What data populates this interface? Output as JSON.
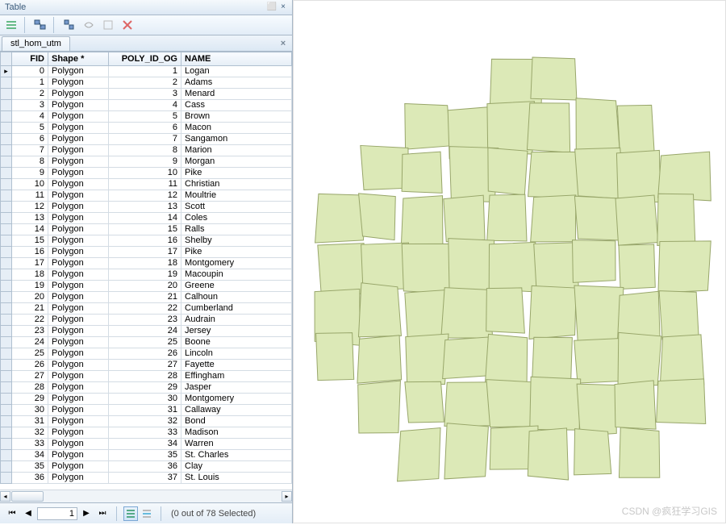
{
  "title": "Table",
  "tab_name": "stl_hom_utm",
  "columns": [
    "FID",
    "Shape *",
    "POLY_ID_OG",
    "NAME"
  ],
  "rows": [
    {
      "fid": 0,
      "shape": "Polygon",
      "poly": 1,
      "name": "Logan"
    },
    {
      "fid": 1,
      "shape": "Polygon",
      "poly": 2,
      "name": "Adams"
    },
    {
      "fid": 2,
      "shape": "Polygon",
      "poly": 3,
      "name": "Menard"
    },
    {
      "fid": 3,
      "shape": "Polygon",
      "poly": 4,
      "name": "Cass"
    },
    {
      "fid": 4,
      "shape": "Polygon",
      "poly": 5,
      "name": "Brown"
    },
    {
      "fid": 5,
      "shape": "Polygon",
      "poly": 6,
      "name": "Macon"
    },
    {
      "fid": 6,
      "shape": "Polygon",
      "poly": 7,
      "name": "Sangamon"
    },
    {
      "fid": 7,
      "shape": "Polygon",
      "poly": 8,
      "name": "Marion"
    },
    {
      "fid": 8,
      "shape": "Polygon",
      "poly": 9,
      "name": "Morgan"
    },
    {
      "fid": 9,
      "shape": "Polygon",
      "poly": 10,
      "name": "Pike"
    },
    {
      "fid": 10,
      "shape": "Polygon",
      "poly": 11,
      "name": "Christian"
    },
    {
      "fid": 11,
      "shape": "Polygon",
      "poly": 12,
      "name": "Moultrie"
    },
    {
      "fid": 12,
      "shape": "Polygon",
      "poly": 13,
      "name": "Scott"
    },
    {
      "fid": 13,
      "shape": "Polygon",
      "poly": 14,
      "name": "Coles"
    },
    {
      "fid": 14,
      "shape": "Polygon",
      "poly": 15,
      "name": "Ralls"
    },
    {
      "fid": 15,
      "shape": "Polygon",
      "poly": 16,
      "name": "Shelby"
    },
    {
      "fid": 16,
      "shape": "Polygon",
      "poly": 17,
      "name": "Pike"
    },
    {
      "fid": 17,
      "shape": "Polygon",
      "poly": 18,
      "name": "Montgomery"
    },
    {
      "fid": 18,
      "shape": "Polygon",
      "poly": 19,
      "name": "Macoupin"
    },
    {
      "fid": 19,
      "shape": "Polygon",
      "poly": 20,
      "name": "Greene"
    },
    {
      "fid": 20,
      "shape": "Polygon",
      "poly": 21,
      "name": "Calhoun"
    },
    {
      "fid": 21,
      "shape": "Polygon",
      "poly": 22,
      "name": "Cumberland"
    },
    {
      "fid": 22,
      "shape": "Polygon",
      "poly": 23,
      "name": "Audrain"
    },
    {
      "fid": 23,
      "shape": "Polygon",
      "poly": 24,
      "name": "Jersey"
    },
    {
      "fid": 24,
      "shape": "Polygon",
      "poly": 25,
      "name": "Boone"
    },
    {
      "fid": 25,
      "shape": "Polygon",
      "poly": 26,
      "name": "Lincoln"
    },
    {
      "fid": 26,
      "shape": "Polygon",
      "poly": 27,
      "name": "Fayette"
    },
    {
      "fid": 27,
      "shape": "Polygon",
      "poly": 28,
      "name": "Effingham"
    },
    {
      "fid": 28,
      "shape": "Polygon",
      "poly": 29,
      "name": "Jasper"
    },
    {
      "fid": 29,
      "shape": "Polygon",
      "poly": 30,
      "name": "Montgomery"
    },
    {
      "fid": 30,
      "shape": "Polygon",
      "poly": 31,
      "name": "Callaway"
    },
    {
      "fid": 31,
      "shape": "Polygon",
      "poly": 32,
      "name": "Bond"
    },
    {
      "fid": 32,
      "shape": "Polygon",
      "poly": 33,
      "name": "Madison"
    },
    {
      "fid": 33,
      "shape": "Polygon",
      "poly": 34,
      "name": "Warren"
    },
    {
      "fid": 34,
      "shape": "Polygon",
      "poly": 35,
      "name": "St. Charles"
    },
    {
      "fid": 35,
      "shape": "Polygon",
      "poly": 36,
      "name": "Clay"
    },
    {
      "fid": 36,
      "shape": "Polygon",
      "poly": 37,
      "name": "St. Louis"
    }
  ],
  "navigator": {
    "page_value": "1",
    "status_text": "(0 out of 78 Selected)"
  },
  "watermark": "CSDN @疯狂学习GIS",
  "icons": {
    "pin": "⊥",
    "close": "×",
    "first": "⏮",
    "prev": "◀",
    "next": "▶",
    "last": "⏭"
  },
  "map": {
    "fill": "#dce9b7",
    "stroke": "#98a66a"
  }
}
